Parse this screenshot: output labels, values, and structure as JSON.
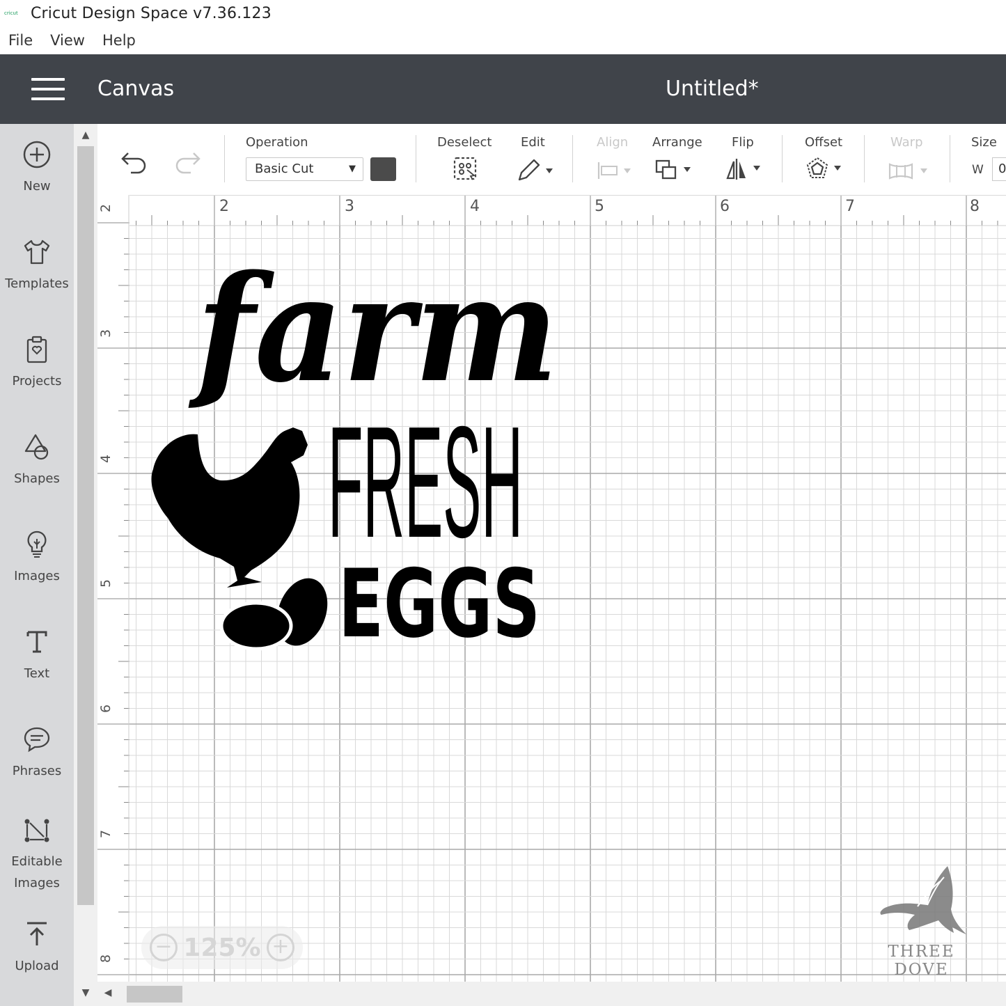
{
  "window": {
    "app_icon_text": "cricut",
    "title": "Cricut Design Space  v7.36.123"
  },
  "menu": [
    "File",
    "View",
    "Help"
  ],
  "header": {
    "section": "Canvas",
    "document": "Untitled*"
  },
  "sidebar": {
    "items": [
      {
        "label": "New",
        "icon": "plus-circle-icon"
      },
      {
        "label": "Templates",
        "icon": "tshirt-icon"
      },
      {
        "label": "Projects",
        "icon": "clipboard-heart-icon"
      },
      {
        "label": "Shapes",
        "icon": "shapes-icon"
      },
      {
        "label": "Images",
        "icon": "lightbulb-icon"
      },
      {
        "label": "Text",
        "icon": "text-t-icon"
      },
      {
        "label": "Phrases",
        "icon": "speech-bubble-icon"
      },
      {
        "label": "Editable Images",
        "icon": "editable-image-icon"
      },
      {
        "label": "Upload",
        "icon": "upload-icon"
      }
    ]
  },
  "toolbar": {
    "operation_label": "Operation",
    "operation_value": "Basic Cut",
    "operation_color": "#4b4b4b",
    "deselect": "Deselect",
    "edit": "Edit",
    "align": "Align",
    "arrange": "Arrange",
    "flip": "Flip",
    "offset": "Offset",
    "warp": "Warp",
    "size": "Size",
    "size_w_label": "W",
    "size_w_value": "0"
  },
  "ruler": {
    "top": [
      "2",
      "3",
      "4",
      "5",
      "6",
      "7",
      "8"
    ],
    "left": [
      "2",
      "3",
      "4",
      "5",
      "6",
      "7",
      "8"
    ]
  },
  "design": {
    "line1": "farm",
    "line2": "FRESH",
    "line3": "EGGS"
  },
  "zoom": {
    "level": "125%",
    "minus": "−",
    "plus": "+"
  },
  "watermark": "THREE DOVE"
}
